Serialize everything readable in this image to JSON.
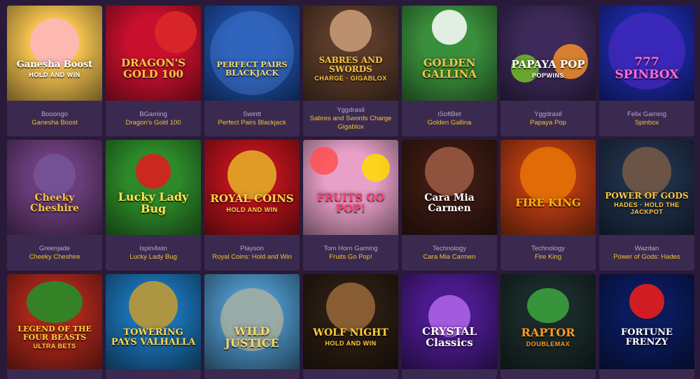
{
  "games": [
    {
      "provider": "Booongo",
      "name": "Ganesha Boost",
      "art": "Ganesha Boost",
      "art_sub": "HOLD AND WIN",
      "icon": "elephant-icon"
    },
    {
      "provider": "BGaming",
      "name": "Dragon's Gold 100",
      "art": "DRAGON'S GOLD 100",
      "art_sub": "",
      "icon": "dragon-icon"
    },
    {
      "provider": "Swintt",
      "name": "Perfect Pairs Blackjack",
      "art": "PERFECT PAIRS BLACKJACK",
      "art_sub": "",
      "icon": "cards-icon"
    },
    {
      "provider": "Yggdrasil",
      "name": "Sabres and Swords Charge Gigablox",
      "art": "SABRES AND SWORDS",
      "art_sub": "CHARGE · GIGABLOX",
      "icon": "soldier-icon"
    },
    {
      "provider": "iSoftBet",
      "name": "Golden Gallina",
      "art": "GOLDEN GALLINA",
      "art_sub": "",
      "icon": "chicken-icon"
    },
    {
      "provider": "Yggdrasil",
      "name": "Papaya Pop",
      "art": "PAPAYA POP",
      "art_sub": "POPWINS",
      "icon": "fruit-icon"
    },
    {
      "provider": "Felix Gaming",
      "name": "Spinbox",
      "art": "777 SPINBOX",
      "art_sub": "",
      "icon": "sevens-icon"
    },
    {
      "provider": "Greenjade",
      "name": "Cheeky Cheshire",
      "art": "Cheeky Cheshire",
      "art_sub": "",
      "icon": "cat-icon"
    },
    {
      "provider": "Ispin4win",
      "name": "Lucky Lady Bug",
      "art": "Lucky Lady Bug",
      "art_sub": "",
      "icon": "ladybug-icon"
    },
    {
      "provider": "Playson",
      "name": "Royal Coins: Hold and Win",
      "art": "ROYAL COINS",
      "art_sub": "HOLD AND WIN",
      "icon": "coin-icon"
    },
    {
      "provider": "Tom Horn Gaming",
      "name": "Fruits Go Pop!",
      "art": "FRUITS GO POP!",
      "art_sub": "",
      "icon": "fruit-icon"
    },
    {
      "provider": "Technology",
      "name": "Cara Mia Carmen",
      "art": "Cara Mia Carmen",
      "art_sub": "",
      "icon": "woman-icon"
    },
    {
      "provider": "Technology",
      "name": "Fire King",
      "art": "FIRE KING",
      "art_sub": "",
      "icon": "king-icon"
    },
    {
      "provider": "Wazdan",
      "name": "Power of Gods: Hades",
      "art": "POWER OF GODS",
      "art_sub": "HADES · HOLD THE JACKPOT",
      "icon": "god-icon"
    },
    {
      "provider": "",
      "name": "",
      "art": "LEGEND OF THE FOUR BEASTS",
      "art_sub": "ULTRA BETS",
      "icon": "dragon-icon"
    },
    {
      "provider": "",
      "name": "",
      "art": "TOWERING PAYS VALHALLA",
      "art_sub": "",
      "icon": "totem-icon"
    },
    {
      "provider": "",
      "name": "",
      "art": "WILD JUSTICE",
      "art_sub": "",
      "icon": "sheriff-icon"
    },
    {
      "provider": "",
      "name": "",
      "art": "WOLF NIGHT",
      "art_sub": "HOLD AND WIN",
      "icon": "wolf-icon"
    },
    {
      "provider": "",
      "name": "",
      "art": "CRYSTAL Classics",
      "art_sub": "",
      "icon": "diamond-icon"
    },
    {
      "provider": "",
      "name": "",
      "art": "RAPTOR",
      "art_sub": "DOUBLEMAX",
      "icon": "raptor-icon"
    },
    {
      "provider": "",
      "name": "",
      "art": "FORTUNE FRENZY",
      "art_sub": "",
      "icon": "sevens-icon"
    }
  ],
  "theme": {
    "background": "#2a1a3a",
    "card_background": "#3b2a50",
    "provider_color": "#b7a9c9",
    "name_color": "#f1c232",
    "thumb_backgrounds": [
      "#f2c14e",
      "#c8102e",
      "#1f4fa8",
      "#5a3b2a",
      "#3a8f3c",
      "#3d2a5a",
      "#1b2aa8",
      "#6a3d7a",
      "#2d8a2a",
      "#b5121b",
      "#e8a0c8",
      "#3a1a12",
      "#b33a12",
      "#1f2f48",
      "#a8261a",
      "#1a6fb0",
      "#4a8fc0",
      "#2a1c12",
      "#4a1a8a",
      "#1a2a2a",
      "#0a1a5a"
    ],
    "art_text_colors": [
      "#ffffff",
      "#f5c542",
      "#f5d76e",
      "#f5c542",
      "#f5c542",
      "#ffffff",
      "#ff6ad5",
      "#f5c542",
      "#ffe34d",
      "#ffd54a",
      "#ff3d6e",
      "#ffffff",
      "#ffb300",
      "#ffc640",
      "#ffcf3a",
      "#ffd54a",
      "#f5d76e",
      "#ffcf3a",
      "#ffffff",
      "#ff9a1a",
      "#ffffff"
    ]
  }
}
